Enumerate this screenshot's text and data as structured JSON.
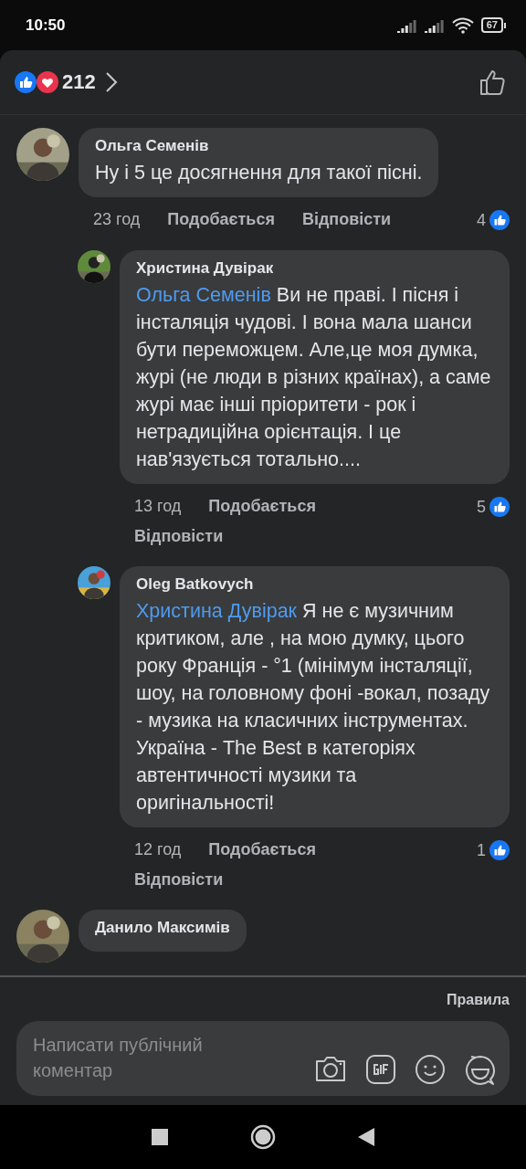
{
  "status_bar": {
    "time": "10:50",
    "battery": "67"
  },
  "reactions": {
    "count": "212"
  },
  "comments": [
    {
      "name": "Ольга Семенів",
      "text": "Ну і 5 це досягнення для такої пісні.",
      "time": "23 год",
      "like_label": "Подобається",
      "reply_label": "Відповісти",
      "likes": "4",
      "children": [
        {
          "name": "Христина Дувірак",
          "mention": "Ольга Семенів",
          "text": "Ви не праві. І пісня і інсталяція чудові. І вона мала шанси бути переможцем. Але,це моя думка, журі (не люди в різних країнах), а саме журі має інші пріоритети - рок і нетрадиційна орієнтація. І це нав'язується тотально....",
          "time": "13 год",
          "like_label": "Подобається",
          "reply_label": "Відповісти",
          "likes": "5"
        },
        {
          "name": "Oleg Batkovych",
          "mention": "Христина Дувірак",
          "text": "Я не є музичним критиком, але , на мою думку, цього року Франція - °1 (мінімум інсталяції, шоу, на головному фоні -вокал, позаду - музика на класичних інструментах.\nУкраїна - The Best  в категоріях автентичності музики та оригінальності!",
          "time": "12 год",
          "like_label": "Подобається",
          "reply_label": "Відповісти",
          "likes": "1"
        }
      ]
    },
    {
      "name": "Данило Максимів"
    }
  ],
  "footer": {
    "rules_link": "Правила",
    "comment_field": {
      "placeholder": "Написати публічний коментар"
    }
  }
}
